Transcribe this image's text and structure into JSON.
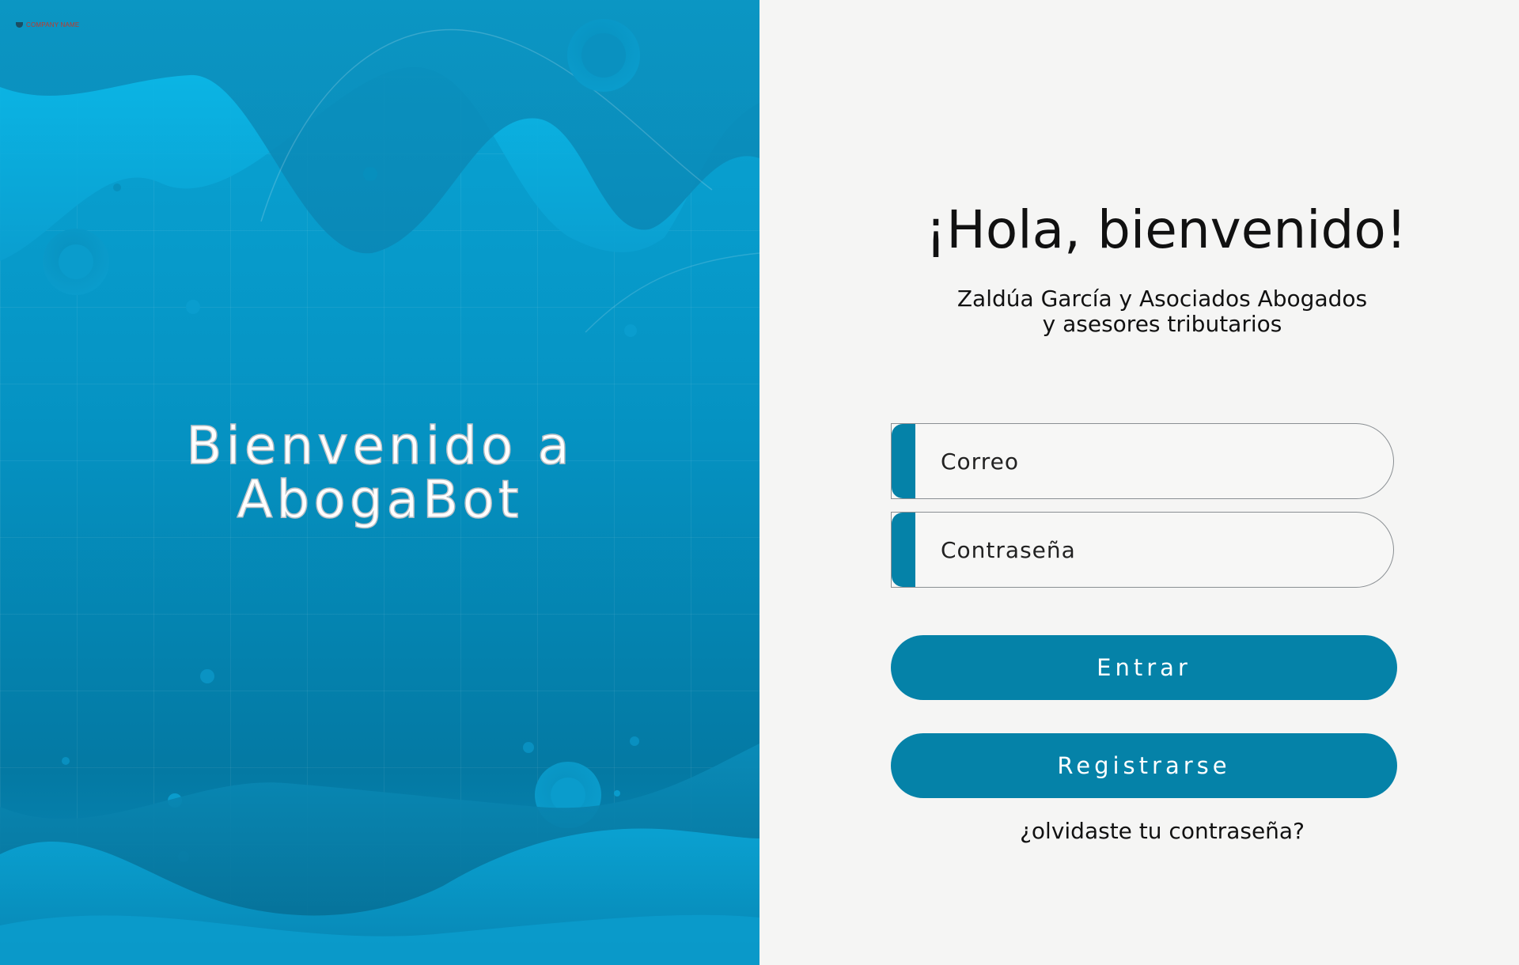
{
  "company": {
    "name": "COMPANY NAME"
  },
  "hero": {
    "title_line1": "Bienvenido a",
    "title_line2": "AbogaBot"
  },
  "login": {
    "greeting": "¡Hola, bienvenido!",
    "firm_line1": "Zaldúa García y Asociados  Abogados",
    "firm_line2": "y asesores tributarios",
    "email_placeholder": "Correo",
    "password_placeholder": "Contraseña",
    "login_button": "Entrar",
    "register_button": "Registrarse",
    "forgot_link": "¿olvidaste tu contraseña?"
  },
  "colors": {
    "accent": "#0582a8",
    "hero_light": "#0aa6d6",
    "hero_dark": "#0479a3",
    "panel_background": "#f5f5f4"
  }
}
